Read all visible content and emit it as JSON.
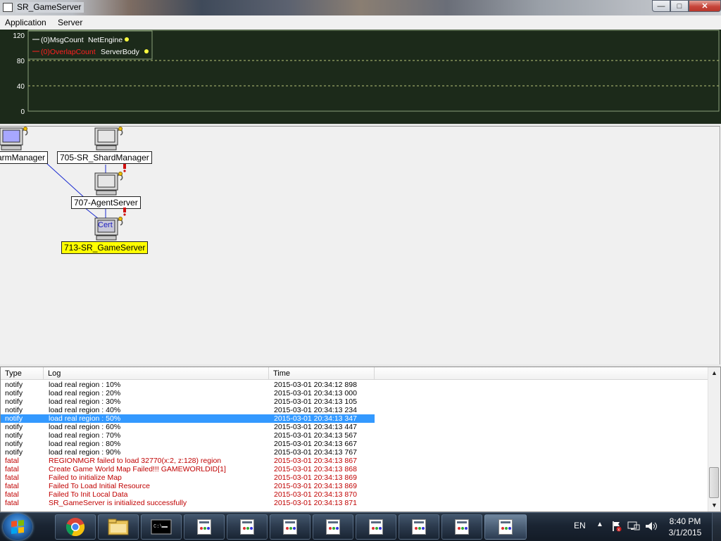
{
  "window": {
    "title": "SR_GameServer",
    "close_glyph": "✕",
    "max_glyph": "□",
    "min_glyph": "—"
  },
  "menu": {
    "items": [
      "Application",
      "Server"
    ]
  },
  "chart_data": {
    "type": "line",
    "title": "",
    "y_ticks": [
      "120",
      "80",
      "40",
      "0"
    ],
    "ylim": [
      0,
      120
    ],
    "grid": true,
    "legend_placement": "top-left",
    "background": "#1c2a1a",
    "series": [
      {
        "name": "(0)MsgCount",
        "group": "NetEngine",
        "color": "#ffffff",
        "values": []
      },
      {
        "name": "(0)OverlapCount",
        "group": "ServerBody",
        "color": "#ff2020",
        "values": []
      }
    ]
  },
  "topology": {
    "nodes": [
      {
        "label": "armManager",
        "selected": false
      },
      {
        "label": "705-SR_ShardManager",
        "selected": false
      },
      {
        "label": "707-AgentServer",
        "selected": false
      },
      {
        "label": "713-SR_GameServer",
        "selected": true,
        "badge": "Cert"
      }
    ]
  },
  "log": {
    "columns": [
      "Type",
      "Log",
      "Time"
    ],
    "rows": [
      {
        "type": "notify",
        "log": "load real region : 10%",
        "time": "2015-03-01 20:34:12 898",
        "level": "notify"
      },
      {
        "type": "notify",
        "log": "load real region : 20%",
        "time": "2015-03-01 20:34:13 000",
        "level": "notify"
      },
      {
        "type": "notify",
        "log": "load real region : 30%",
        "time": "2015-03-01 20:34:13 105",
        "level": "notify"
      },
      {
        "type": "notify",
        "log": "load real region : 40%",
        "time": "2015-03-01 20:34:13 234",
        "level": "notify"
      },
      {
        "type": "notify",
        "log": "load real region : 50%",
        "time": "2015-03-01 20:34:13 347",
        "level": "notify",
        "selected": true
      },
      {
        "type": "notify",
        "log": "load real region : 60%",
        "time": "2015-03-01 20:34:13 447",
        "level": "notify"
      },
      {
        "type": "notify",
        "log": "load real region : 70%",
        "time": "2015-03-01 20:34:13 567",
        "level": "notify"
      },
      {
        "type": "notify",
        "log": "load real region : 80%",
        "time": "2015-03-01 20:34:13 667",
        "level": "notify"
      },
      {
        "type": "notify",
        "log": "load real region : 90%",
        "time": "2015-03-01 20:34:13 767",
        "level": "notify"
      },
      {
        "type": "fatal",
        "log": "REGIONMGR failed to load 32770(x:2, z:128) region",
        "time": "2015-03-01 20:34:13 867",
        "level": "fatal"
      },
      {
        "type": "fatal",
        "log": "Create Game World Map Failed!!! GAMEWORLDID[1]",
        "time": "2015-03-01 20:34:13 868",
        "level": "fatal"
      },
      {
        "type": "fatal",
        "log": "Failed to initialize Map",
        "time": "2015-03-01 20:34:13 869",
        "level": "fatal"
      },
      {
        "type": "fatal",
        "log": "Failed To Load Initial Resource",
        "time": "2015-03-01 20:34:13 869",
        "level": "fatal"
      },
      {
        "type": "fatal",
        "log": "Failed To Init Local Data",
        "time": "2015-03-01 20:34:13 870",
        "level": "fatal"
      },
      {
        "type": "fatal",
        "log": "SR_GameServer is initialized successfully",
        "time": "2015-03-01 20:34:13 871",
        "level": "fatal"
      }
    ],
    "colors": {
      "notify": "#000000",
      "fatal": "#c00000",
      "selected_bg": "#3399ff",
      "selected_fg": "#ffffff"
    }
  },
  "taskbar": {
    "language": "EN",
    "time": "8:40 PM",
    "date": "3/1/2015",
    "pinned": [
      "windows-start",
      "chrome",
      "file-explorer",
      "command-prompt"
    ],
    "open_windows": 8
  }
}
